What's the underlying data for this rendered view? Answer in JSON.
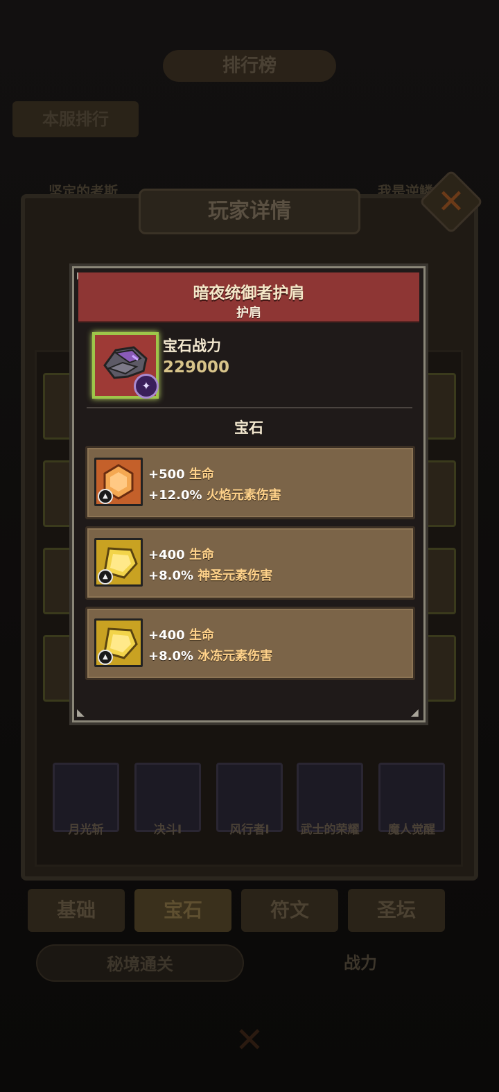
{
  "background": {
    "title": "排行榜",
    "server_tab": "本服排行",
    "rank_names": [
      "坚定的考斯",
      "我是逆鳞"
    ],
    "panel_title": "玩家详情",
    "close_glyph": "✕",
    "skills": [
      "月光斩",
      "决斗I",
      "风行者I",
      "武士的荣耀",
      "魔人觉醒"
    ],
    "bottom_tabs": [
      "基础",
      "宝石",
      "符文",
      "圣坛"
    ],
    "active_bottom_tab": "宝石",
    "sub_tabs": [
      "秘境通关",
      "战力"
    ],
    "bottom_close_glyph": "✕"
  },
  "popup": {
    "item_name": "暗夜统御者护肩",
    "item_slot": "护肩",
    "gem_power_label": "宝石战力",
    "gem_power_value": "229000",
    "section_title": "宝石",
    "badge_icon": "class-emblem-icon",
    "gems": [
      {
        "color": "orange",
        "hex": "#c4602a",
        "line1_value": "+500",
        "line1_stat": "生命",
        "line2_value": "+12.0%",
        "line2_stat": "火焰元素伤害"
      },
      {
        "color": "yellow",
        "hex": "#c9a222",
        "line1_value": "+400",
        "line1_stat": "生命",
        "line2_value": "+8.0%",
        "line2_stat": "神圣元素伤害"
      },
      {
        "color": "yellow",
        "hex": "#c9a222",
        "line1_value": "+400",
        "line1_stat": "生命",
        "line2_value": "+8.0%",
        "line2_stat": "冰冻元素伤害"
      }
    ]
  },
  "colors": {
    "popup_header": "#8e3634",
    "gem_card": "#7b6448",
    "stat_text": "#ffd28a",
    "power_value": "#d8c48a"
  }
}
